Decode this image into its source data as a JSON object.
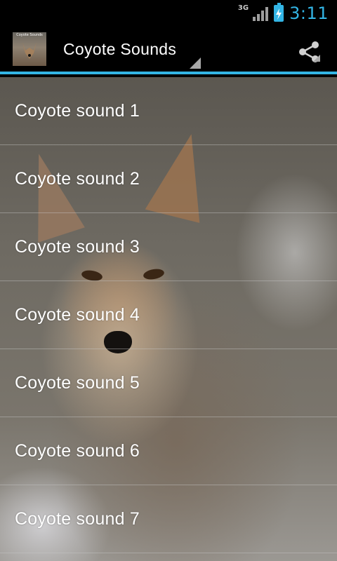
{
  "status_bar": {
    "network_type": "3G",
    "time": "3:11",
    "icons": [
      "signal-icon",
      "battery-charging-icon"
    ]
  },
  "action_bar": {
    "app_icon_text": "Coyote Sounds",
    "title": "Coyote Sounds",
    "share_icon": "share-icon"
  },
  "colors": {
    "accent": "#33b5e5",
    "background": "#000000",
    "text": "#ffffff"
  },
  "list": {
    "items": [
      {
        "label": "Coyote sound 1"
      },
      {
        "label": "Coyote sound 2"
      },
      {
        "label": "Coyote sound 3"
      },
      {
        "label": "Coyote sound 4"
      },
      {
        "label": "Coyote sound 5"
      },
      {
        "label": "Coyote sound 6"
      },
      {
        "label": "Coyote sound 7"
      }
    ]
  }
}
